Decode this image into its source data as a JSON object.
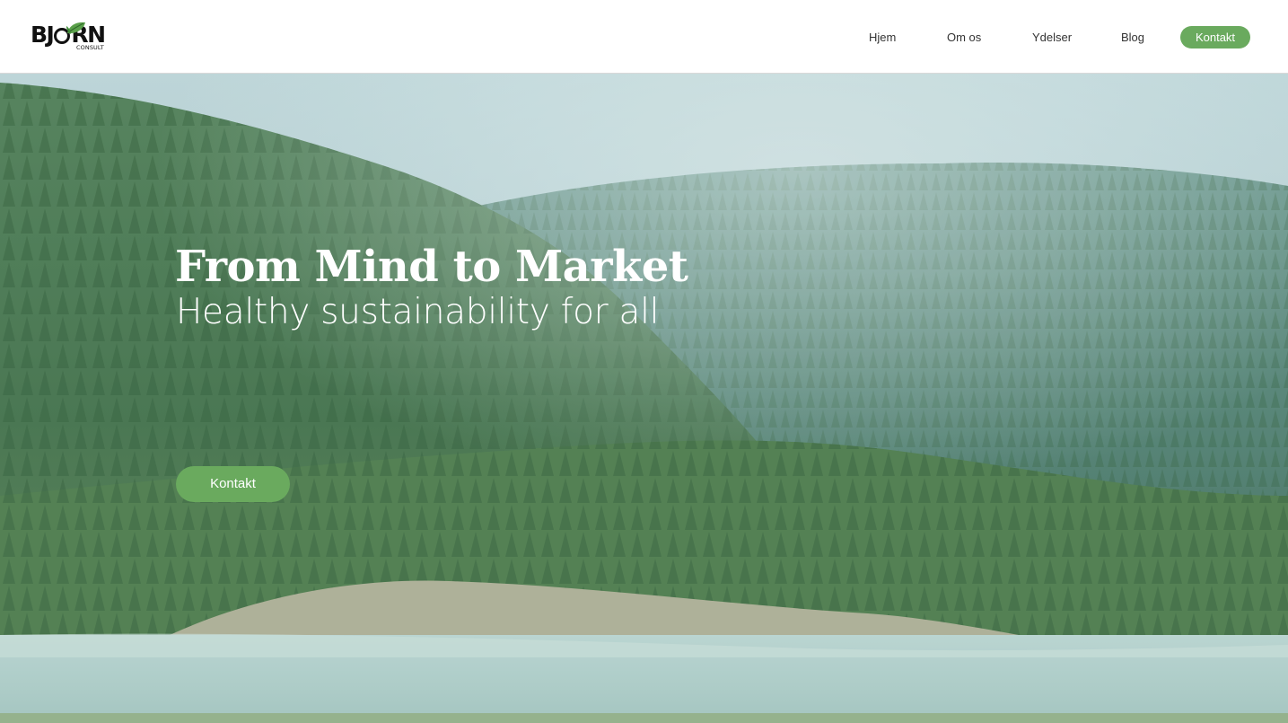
{
  "brand": {
    "logo_text": "BJØRN",
    "logo_parts": [
      "BJ",
      "RN"
    ],
    "logo_subtitle": "CONSULT",
    "logo_color": "#111111",
    "leaf_color": "#5aa04a"
  },
  "nav": {
    "items": [
      {
        "label": "Hjem",
        "icon": ""
      },
      {
        "label": "Om os",
        "icon": ""
      },
      {
        "label": "Ydelser",
        "icon": ""
      },
      {
        "label": "Blog",
        "icon": ""
      }
    ],
    "cta_label": "Kontakt"
  },
  "hero": {
    "title": "From Mind to Market",
    "subtitle": "Healthy sustainability for all",
    "cta_label": "Kontakt",
    "background": "forest-lake-photo"
  },
  "colors": {
    "accent": "#6aaa5e",
    "header_bg": "#ffffff",
    "nav_text": "#333333",
    "hero_text": "#ffffff"
  }
}
